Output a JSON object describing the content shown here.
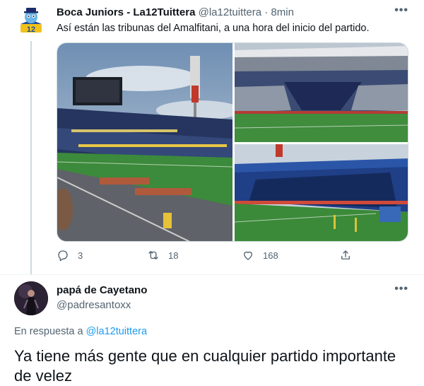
{
  "tweet1": {
    "author_name": "Boca Juniors - La12Tuittera",
    "author_handle": "@la12tuittera",
    "separator": "·",
    "time": "8min",
    "text": "Así están las tribunas del Amalfitani, a una hora del inicio del partido.",
    "more_icon": "more-icon",
    "stats": {
      "replies": "3",
      "retweets": "18",
      "likes": "168"
    },
    "media": [
      {
        "icon": "stadium-photo-1"
      },
      {
        "icon": "stadium-photo-2"
      },
      {
        "icon": "stadium-photo-3"
      }
    ]
  },
  "tweet2": {
    "author_name": "papá de Cayetano",
    "author_handle": "@padresantoxx",
    "reply_prefix": "En respuesta a",
    "reply_to": "@la12tuittera",
    "text": "Ya tiene más gente que en cualquier partido importante de velez"
  },
  "colors": {
    "link": "#1d9bf0",
    "muted": "#536471",
    "text": "#0f1419",
    "border": "#cfd9de"
  }
}
